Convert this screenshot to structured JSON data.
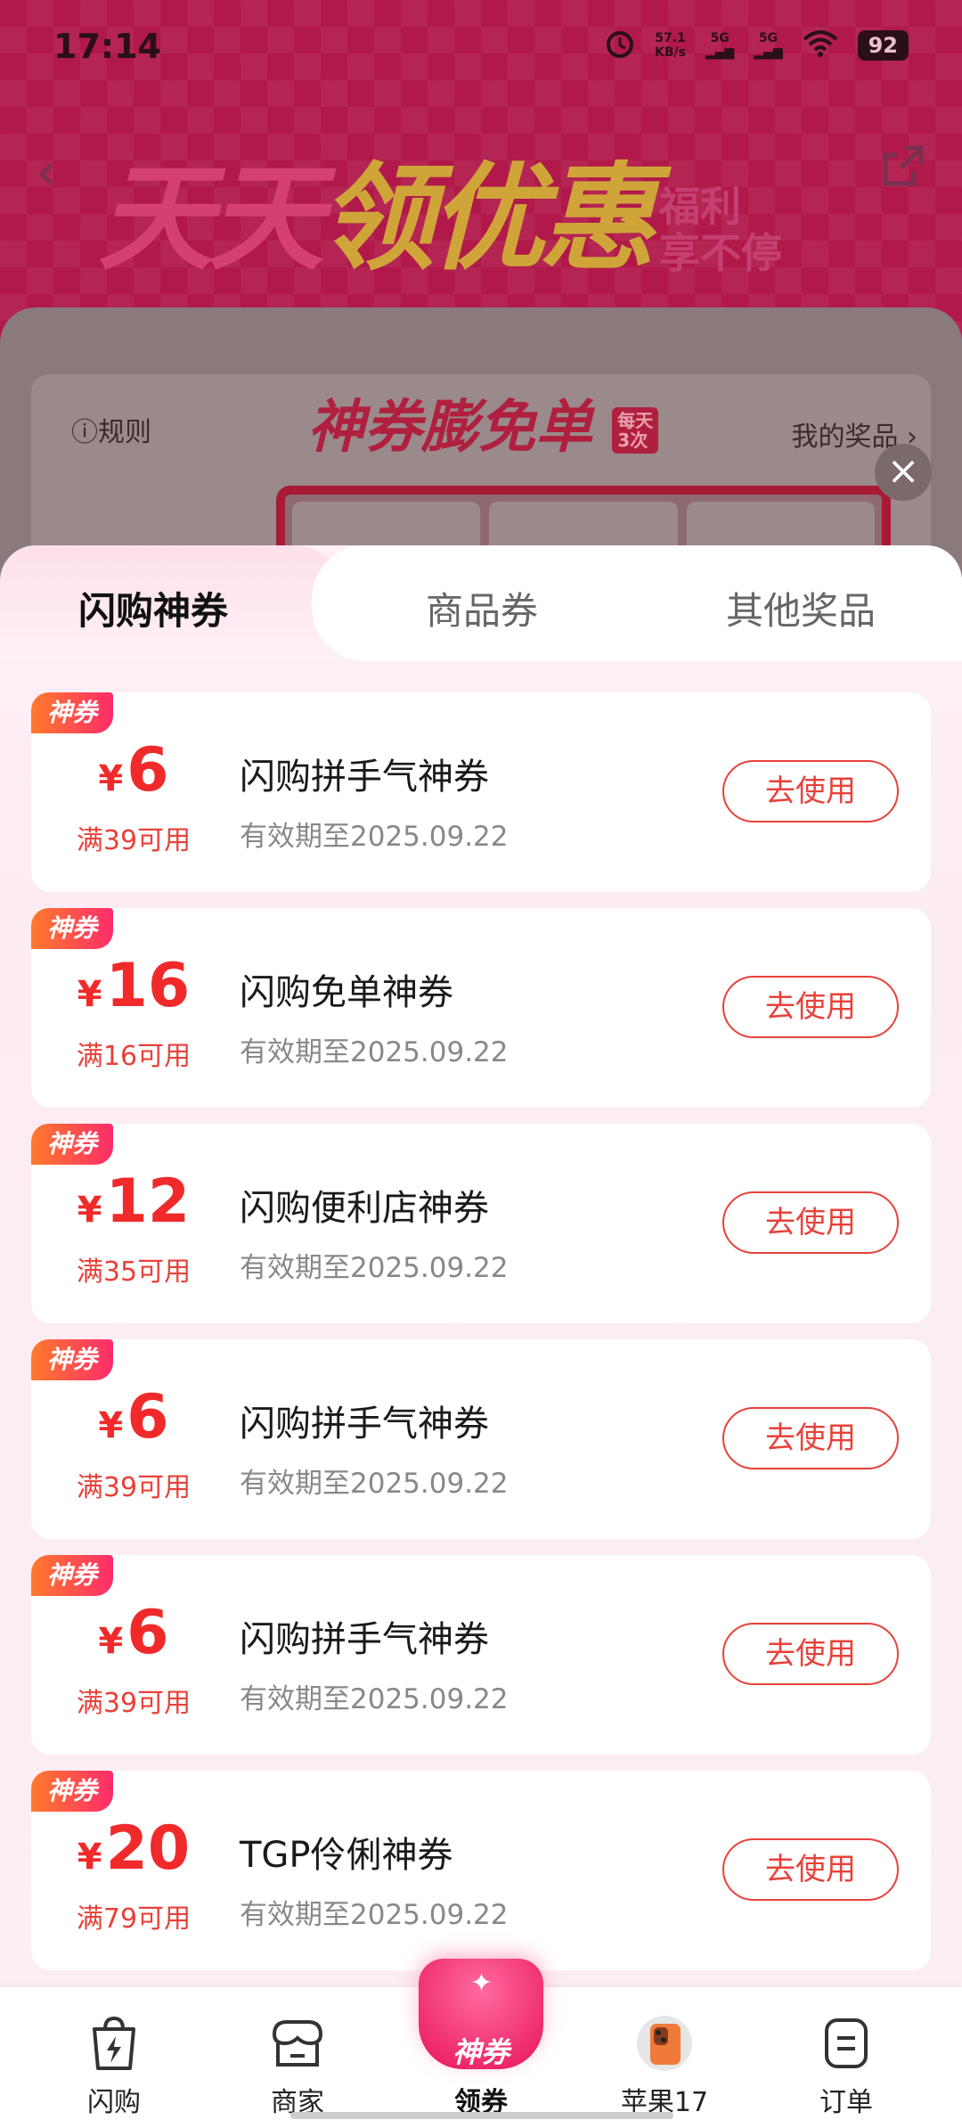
{
  "status_bar": {
    "time": "17:14",
    "net_speed_value": "57.1",
    "net_speed_unit": "KB/s",
    "sim1": "5G",
    "sim2": "5G",
    "battery": "92"
  },
  "banner": {
    "title_part1": "天天",
    "title_part2": "领优惠",
    "subtitle_line1": "福利",
    "subtitle_line2": "享不停"
  },
  "promo": {
    "rules_label": "ⓘ规则",
    "title": "神券膨免单",
    "badge_line1": "每天",
    "badge_line2": "3次",
    "my_prizes_label": "我的奖品 ›"
  },
  "sheet": {
    "tabs": [
      {
        "label": "闪购神券",
        "active": true
      },
      {
        "label": "商品券",
        "active": false
      },
      {
        "label": "其他奖品",
        "active": false
      }
    ],
    "coupons": [
      {
        "tag": "神券",
        "currency": "¥",
        "amount": "6",
        "threshold": "满39可用",
        "name": "闪购拼手气神券",
        "expiry": "有效期至2025.09.22",
        "button": "去使用"
      },
      {
        "tag": "神券",
        "currency": "¥",
        "amount": "16",
        "threshold": "满16可用",
        "name": "闪购免单神券",
        "expiry": "有效期至2025.09.22",
        "button": "去使用"
      },
      {
        "tag": "神券",
        "currency": "¥",
        "amount": "12",
        "threshold": "满35可用",
        "name": "闪购便利店神券",
        "expiry": "有效期至2025.09.22",
        "button": "去使用"
      },
      {
        "tag": "神券",
        "currency": "¥",
        "amount": "6",
        "threshold": "满39可用",
        "name": "闪购拼手气神券",
        "expiry": "有效期至2025.09.22",
        "button": "去使用"
      },
      {
        "tag": "神券",
        "currency": "¥",
        "amount": "6",
        "threshold": "满39可用",
        "name": "闪购拼手气神券",
        "expiry": "有效期至2025.09.22",
        "button": "去使用"
      },
      {
        "tag": "神券",
        "currency": "¥",
        "amount": "20",
        "threshold": "满79可用",
        "name": "TGP伶俐神券",
        "expiry": "有效期至2025.09.22",
        "button": "去使用"
      }
    ]
  },
  "bottom_nav": {
    "items": [
      {
        "label": "闪购",
        "icon": "lightning-bag-icon"
      },
      {
        "label": "商家",
        "icon": "storefront-icon"
      },
      {
        "label": "领券",
        "icon": "coupon-envelope-icon",
        "active": true,
        "badge_text": "神券"
      },
      {
        "label": "苹果17",
        "icon": "iphone-icon"
      },
      {
        "label": "订单",
        "icon": "order-list-icon"
      }
    ]
  },
  "colors": {
    "accent_red": "#e8413a",
    "tag_gradient_start": "#ff7a2c",
    "tag_gradient_end": "#ff2c6a",
    "banner_bg": "#b0194a"
  }
}
